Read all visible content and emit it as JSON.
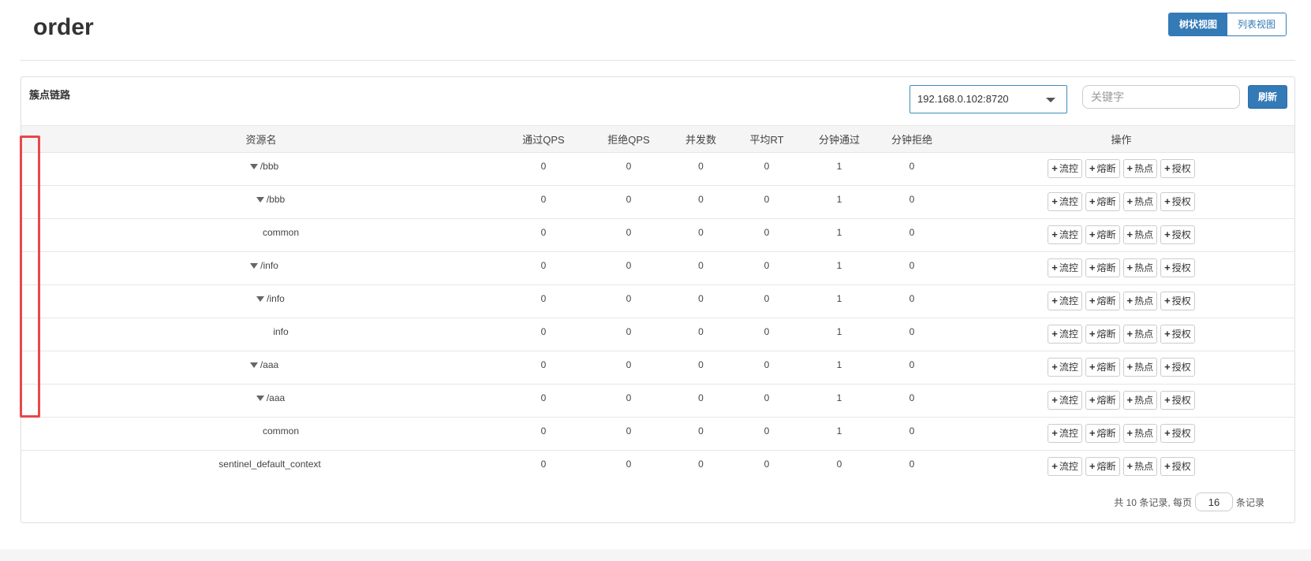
{
  "page": {
    "title": "order"
  },
  "view_toggle": {
    "tree_label": "树状视图",
    "list_label": "列表视图"
  },
  "panel": {
    "title": "簇点链路",
    "machine_select": "192.168.0.102:8720",
    "search_placeholder": "关键字",
    "refresh_label": "刷新"
  },
  "table": {
    "headers": [
      "资源名",
      "通过QPS",
      "拒绝QPS",
      "并发数",
      "平均RT",
      "分钟通过",
      "分钟拒绝",
      "操作"
    ],
    "op_buttons": [
      "流控",
      "熔断",
      "热点",
      "授权"
    ],
    "rows": [
      {
        "name": "/bbb",
        "level": 0,
        "toggle": true,
        "values": [
          "0",
          "0",
          "0",
          "0",
          "1",
          "0"
        ]
      },
      {
        "name": "/bbb",
        "level": 1,
        "toggle": true,
        "values": [
          "0",
          "0",
          "0",
          "0",
          "1",
          "0"
        ]
      },
      {
        "name": "common",
        "level": 2,
        "toggle": false,
        "values": [
          "0",
          "0",
          "0",
          "0",
          "1",
          "0"
        ]
      },
      {
        "name": "/info",
        "level": 0,
        "toggle": true,
        "values": [
          "0",
          "0",
          "0",
          "0",
          "1",
          "0"
        ]
      },
      {
        "name": "/info",
        "level": 1,
        "toggle": true,
        "values": [
          "0",
          "0",
          "0",
          "0",
          "1",
          "0"
        ]
      },
      {
        "name": "info",
        "level": 2,
        "toggle": false,
        "values": [
          "0",
          "0",
          "0",
          "0",
          "1",
          "0"
        ]
      },
      {
        "name": "/aaa",
        "level": 0,
        "toggle": true,
        "values": [
          "0",
          "0",
          "0",
          "0",
          "1",
          "0"
        ]
      },
      {
        "name": "/aaa",
        "level": 1,
        "toggle": true,
        "values": [
          "0",
          "0",
          "0",
          "0",
          "1",
          "0"
        ]
      },
      {
        "name": "common",
        "level": 2,
        "toggle": false,
        "values": [
          "0",
          "0",
          "0",
          "0",
          "1",
          "0"
        ]
      },
      {
        "name": "sentinel_default_context",
        "level": 3,
        "toggle": false,
        "values": [
          "0",
          "0",
          "0",
          "0",
          "0",
          "0"
        ]
      }
    ]
  },
  "pagination": {
    "prefix": "共 10 条记录, 每页",
    "page_size": "16",
    "suffix": "条记录"
  },
  "colors": {
    "primary": "#337ab7",
    "highlight": "#e8474c"
  },
  "icons": {
    "toggle": "caret-down-icon",
    "plus": "plus-icon"
  }
}
